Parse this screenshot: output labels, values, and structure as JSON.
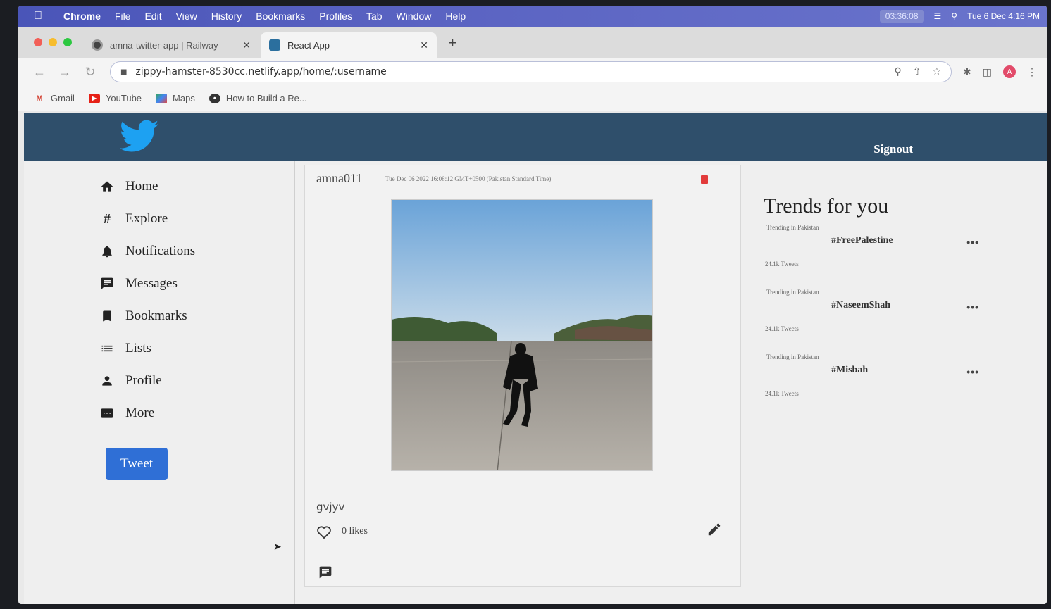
{
  "menubar": {
    "app": "Chrome",
    "items": [
      "File",
      "Edit",
      "View",
      "History",
      "Bookmarks",
      "Profiles",
      "Tab",
      "Window",
      "Help"
    ],
    "timer": "03:36:08",
    "clock": "Tue 6 Dec  4:16 PM"
  },
  "tabs": [
    {
      "title": "amna-twitter-app | Railway",
      "active": false
    },
    {
      "title": "React App",
      "active": true
    }
  ],
  "address": {
    "url": "zippy-hamster-8530cc.netlify.app/home/:username"
  },
  "bookmarks": [
    "Gmail",
    "YouTube",
    "Maps",
    "How to Build a Re..."
  ],
  "header": {
    "signout_label": "Signout"
  },
  "sidebar": {
    "items": [
      {
        "label": "Home",
        "icon": "home-icon"
      },
      {
        "label": "Explore",
        "icon": "hashtag-icon"
      },
      {
        "label": "Notifications",
        "icon": "bell-icon"
      },
      {
        "label": "Messages",
        "icon": "message-icon"
      },
      {
        "label": "Bookmarks",
        "icon": "bookmark-icon"
      },
      {
        "label": "Lists",
        "icon": "list-icon"
      },
      {
        "label": "Profile",
        "icon": "person-icon"
      },
      {
        "label": "More",
        "icon": "more-icon"
      }
    ],
    "tweet_label": "Tweet"
  },
  "post": {
    "username": "amna011",
    "timestamp": "Tue Dec 06 2022 16:08:12 GMT+0500 (Pakistan Standard Time)",
    "caption": "gvjyv",
    "likes": "0 likes"
  },
  "trends": {
    "title": "Trends for you",
    "items": [
      {
        "location": "Trending in Pakistan",
        "tag": "#FreePalestine",
        "count": "24.1k Tweets"
      },
      {
        "location": "Trending in Pakistan",
        "tag": "#NaseemShah",
        "count": "24.1k Tweets"
      },
      {
        "location": "Trending in Pakistan",
        "tag": "#Misbah",
        "count": "24.1k Tweets"
      }
    ]
  },
  "colors": {
    "header": "#2f4f6b",
    "tweet_button": "#2f6fd6",
    "delete": "#e23b3b"
  }
}
